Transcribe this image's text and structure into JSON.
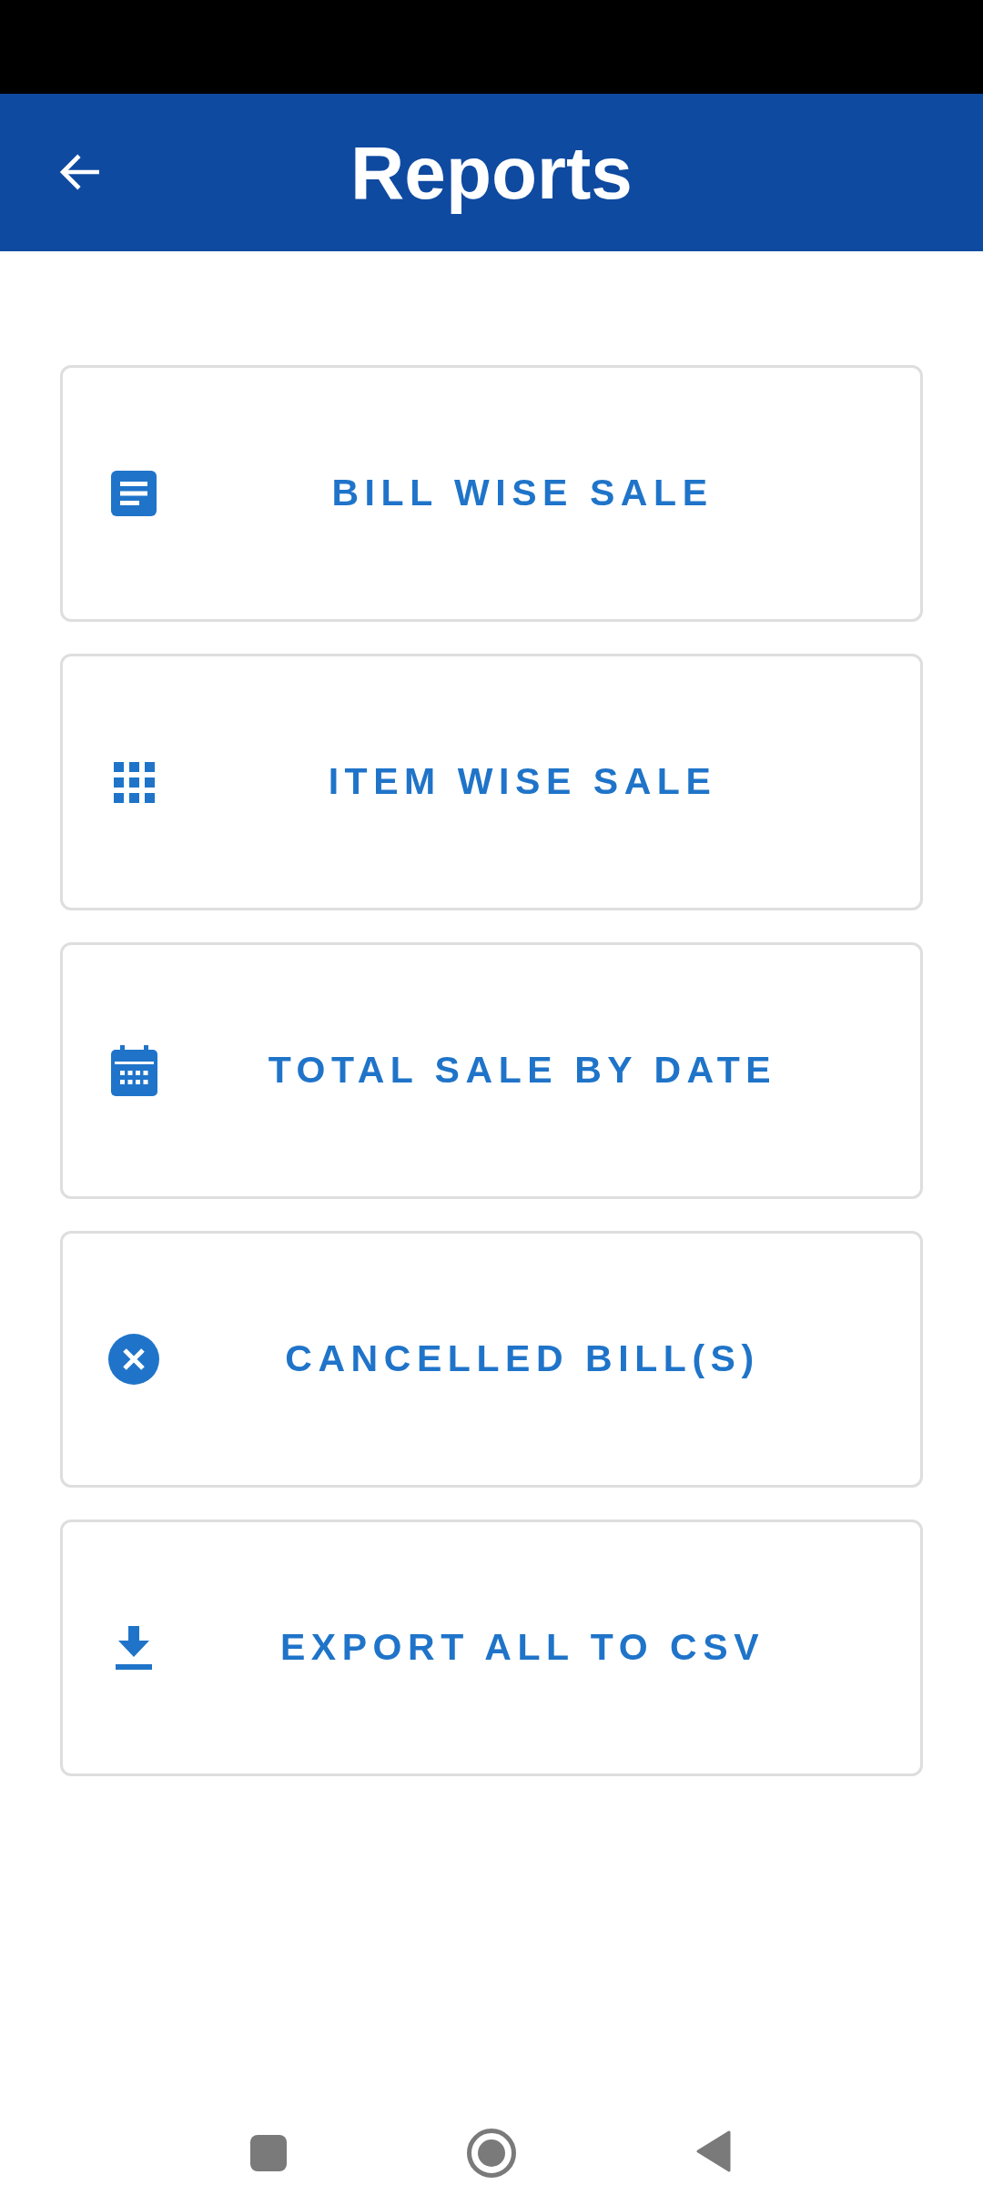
{
  "header": {
    "title": "Reports"
  },
  "reports": [
    {
      "kind": "document",
      "label": "BILL WISE SALE"
    },
    {
      "kind": "grid",
      "label": "ITEM WISE SALE"
    },
    {
      "kind": "calendar",
      "label": "TOTAL SALE BY DATE"
    },
    {
      "kind": "cancel",
      "label": "CANCELLED BILL(S)"
    },
    {
      "kind": "download",
      "label": "EXPORT ALL TO CSV"
    }
  ]
}
